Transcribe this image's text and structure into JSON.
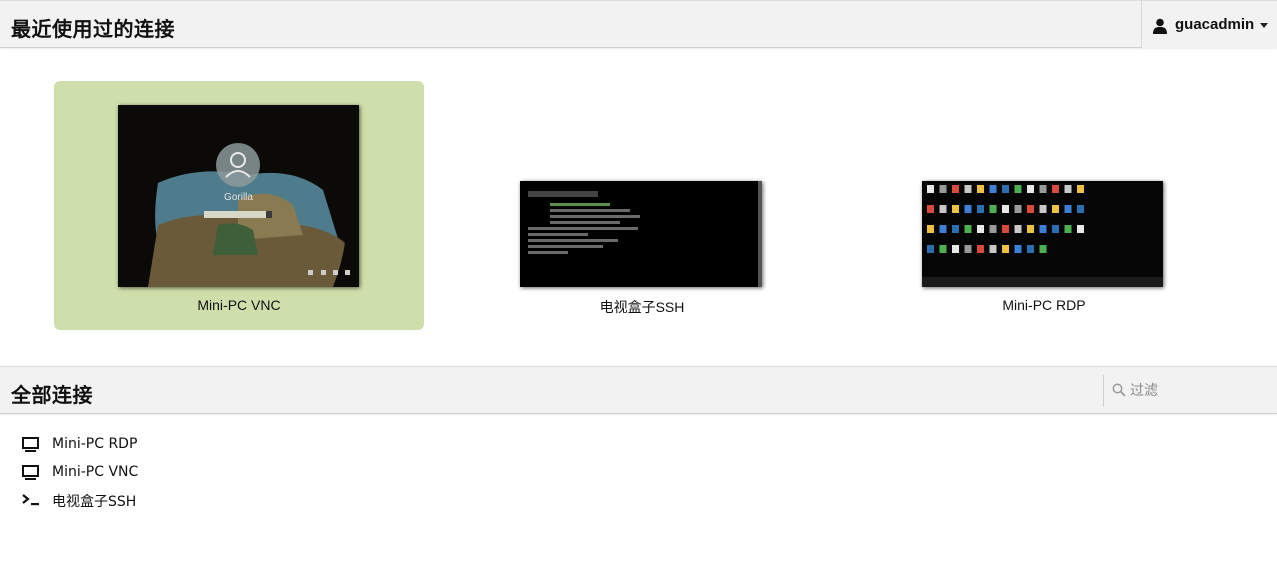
{
  "header": {
    "recent_title": "最近使用过的连接",
    "user_name": "guacadmin"
  },
  "recent": [
    {
      "label": "Mini-PC VNC",
      "active": true,
      "preview_text": "Gorilla"
    },
    {
      "label": "电视盒子SSH",
      "active": false
    },
    {
      "label": "Mini-PC RDP",
      "active": false
    }
  ],
  "all": {
    "title": "全部连接",
    "filter_placeholder": "过滤",
    "items": [
      {
        "label": "Mini-PC RDP",
        "icon": "monitor-icon"
      },
      {
        "label": "Mini-PC VNC",
        "icon": "monitor-icon"
      },
      {
        "label": "电视盒子SSH",
        "icon": "terminal-icon"
      }
    ]
  },
  "colors": {
    "active_tile": "#cfdfab",
    "header_bg": "#f2f2f2"
  }
}
